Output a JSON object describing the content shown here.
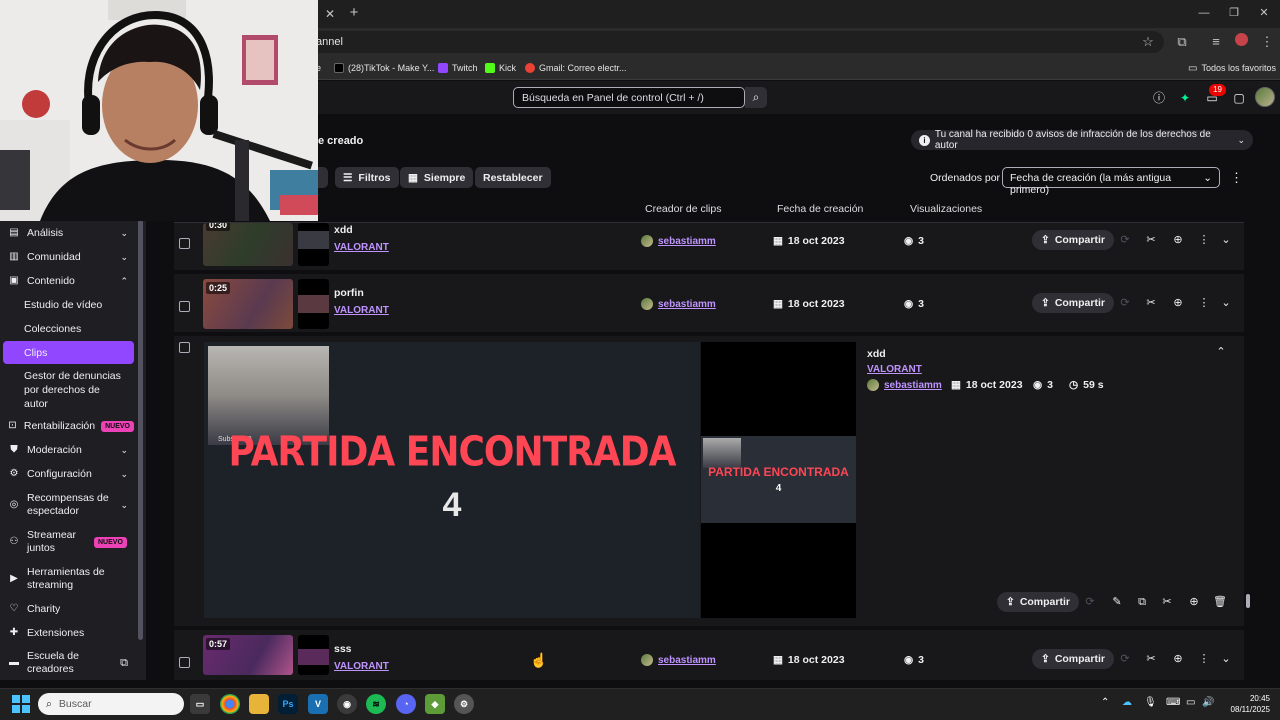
{
  "browser": {
    "url": "annel",
    "bookmarks": [
      {
        "label": "e",
        "color": "#777777"
      },
      {
        "label": "(28)TikTok - Make Y...",
        "color": "#000000"
      },
      {
        "label": "Twitch",
        "color": "#9146ff"
      },
      {
        "label": "Kick",
        "color": "#53fc18"
      },
      {
        "label": "Gmail: Correo electr...",
        "color": "#ea4335"
      }
    ],
    "all_bookmarks": "Todos los favoritos"
  },
  "topnav": {
    "search_placeholder": "Búsqueda en Panel de control (Ctrl + /)",
    "notification_count": "19"
  },
  "sidebar": {
    "items": [
      {
        "label": "Análisis",
        "icon": "chart-icon",
        "chevron": "down"
      },
      {
        "label": "Comunidad",
        "icon": "community-icon",
        "chevron": "down"
      },
      {
        "label": "Contenido",
        "icon": "content-icon",
        "chevron": "up"
      }
    ],
    "sub_items": [
      "Estudio de vídeo",
      "Colecciones",
      "Clips",
      "Gestor de denuncias",
      "por derechos de",
      "autor"
    ],
    "items_lower": [
      {
        "label": "Rentabilización",
        "badge": "NUEVO"
      },
      {
        "label": "Moderación"
      },
      {
        "label": "Configuración"
      },
      {
        "label_1": "Recompensas de",
        "label_2": "espectador"
      },
      {
        "label_1": "Streamear",
        "label_2": "juntos",
        "badge": "NUEVO"
      },
      {
        "label_1": "Herramientas de",
        "label_2": "streaming"
      },
      {
        "label": "Charity"
      },
      {
        "label": "Extensiones"
      },
      {
        "label_1": "Escuela de",
        "label_2": "creadores"
      }
    ]
  },
  "main": {
    "title": "e creado",
    "copyright_notice": "Tu canal ha recibido 0 avisos de infracción de los derechos de autor",
    "filters": {
      "filtros": "Filtros",
      "siempre": "Siempre",
      "reset": "Restablecer"
    },
    "sort_label": "Ordenados por",
    "sort_value": "Fecha de creación (la más antigua primero)",
    "columns": {
      "creator": "Creador de clips",
      "date": "Fecha de creación",
      "views": "Visualizaciones"
    },
    "share_label": "Compartir",
    "rows": [
      {
        "duration": "0:30",
        "title": "xdd",
        "game": "VALORANT",
        "creator": "sebastiamm",
        "date": "18 oct 2023",
        "views": "3"
      },
      {
        "duration": "0:25",
        "title": "porfin",
        "game": "VALORANT",
        "creator": "sebastiamm",
        "date": "18 oct 2023",
        "views": "3"
      }
    ],
    "expanded": {
      "title": "xdd",
      "game": "VALORANT",
      "creator": "sebastiamm",
      "date": "18 oct 2023",
      "views": "3",
      "length": "59 s",
      "video_text": "PARTIDA ENCONTRADA",
      "countdown": "4",
      "subs": "Subs: 0/10"
    },
    "last_row": {
      "duration": "0:57",
      "title": "sss",
      "game": "VALORANT",
      "creator": "sebastiamm",
      "date": "18 oct 2023",
      "views": "3"
    }
  },
  "taskbar": {
    "search": "Buscar",
    "time": "20:45",
    "date": "08/11/2025"
  }
}
